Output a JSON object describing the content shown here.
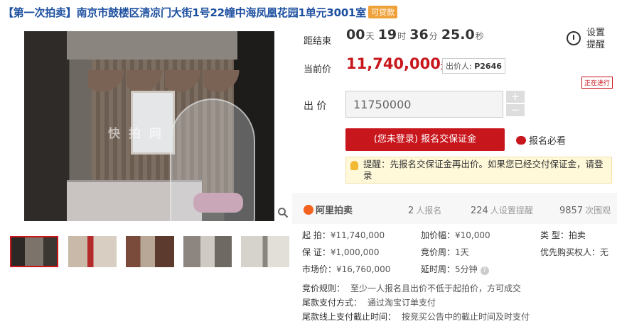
{
  "title": {
    "text": "【第一次拍卖】南京市鼓楼区清凉门大街1号22幢中海凤凰花园1单元3001室",
    "tag": "可贷款"
  },
  "image": {
    "watermark": "快 拍 网"
  },
  "countdown": {
    "label": "距结束",
    "days": "00",
    "days_unit": "天",
    "hours": "19",
    "hours_unit": "时",
    "minutes": "36",
    "minutes_unit": "分",
    "seconds": "25.0",
    "seconds_unit": "秒"
  },
  "settings": {
    "label": "设置提醒"
  },
  "current_price": {
    "label": "当前价",
    "value": "11,740,000",
    "unit": "元",
    "bidder_label": "出价人:",
    "bidder_id": "P2646"
  },
  "status_tag": "正在进行",
  "bid": {
    "label": "出 价",
    "value": "11750000",
    "plus": "+",
    "minus": "−"
  },
  "signup_button": "(您未登录) 报名交保证金",
  "must_read": "报名必看",
  "notice": "提醒：先报名交保证金再出价。如果您已经交付保证金，请登录",
  "stats": {
    "brand": "阿里拍卖",
    "signups_count": "2",
    "signups_label": "人报名",
    "reminders_count": "224",
    "reminders_label": "人设置提醒",
    "views_count": "9857",
    "views_label": "次围观"
  },
  "details": {
    "start_label": "起    拍：",
    "start_value": "¥11,740,000",
    "increment_label": "加价幅：",
    "increment_value": "¥10,000",
    "type_label": "类    型：",
    "type_value": "拍卖",
    "deposit_label": "保    证：",
    "deposit_value": "¥1,000,000",
    "period_label": "竞价周：",
    "period_value": "1天",
    "priority_label": "优先购买权人：",
    "priority_value": "无",
    "market_label": "市场价：",
    "market_value": "¥16,760,000",
    "delay_label": "延时周：",
    "delay_value": "5分钟"
  },
  "rules": [
    {
      "label": "竞价规则：",
      "value": "至少一人报名且出价不低于起拍价，方可成交"
    },
    {
      "label": "尾款支付方式：",
      "value": "通过淘宝订单支付"
    },
    {
      "label": "尾款线上支付截止时间：",
      "value": "按竞买公告中的截止时间及时支付"
    }
  ],
  "colors": {
    "accent": "#c8161d",
    "title": "#1d4fa0",
    "tag": "#f0a23a"
  }
}
